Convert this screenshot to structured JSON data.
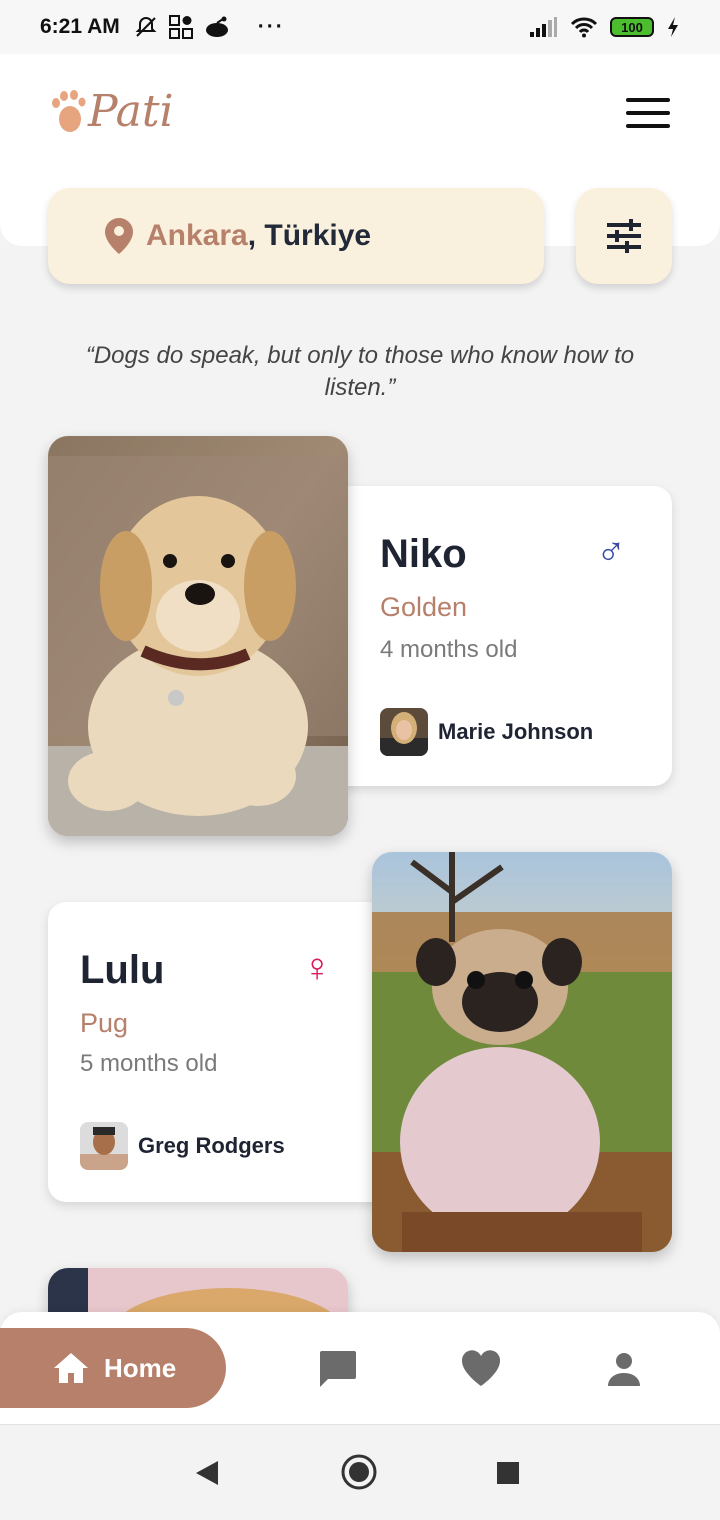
{
  "status_bar": {
    "time": "6:21 AM",
    "battery": "100",
    "dots": "···"
  },
  "app": {
    "logo_text": "Pati"
  },
  "location": {
    "city": "Ankara",
    "separator": ", ",
    "country": "Türkiye"
  },
  "quote": "“Dogs do speak, but only to those who know how to listen.”",
  "pets": [
    {
      "name": "Niko",
      "breed": "Golden",
      "age": "4 months old",
      "owner": "Marie Johnson",
      "gender_symbol": "♂",
      "gender_color": "#3a4aa6"
    },
    {
      "name": "Lulu",
      "breed": "Pug",
      "age": "5 months old",
      "owner": "Greg Rodgers",
      "gender_symbol": "♀",
      "gender_color": "#d81b60"
    }
  ],
  "nav": {
    "home_label": "Home",
    "items": [
      "chat-icon",
      "heart-icon",
      "profile-icon"
    ]
  },
  "colors": {
    "accent": "#b6806a",
    "pill_bg": "#f9f0de"
  }
}
